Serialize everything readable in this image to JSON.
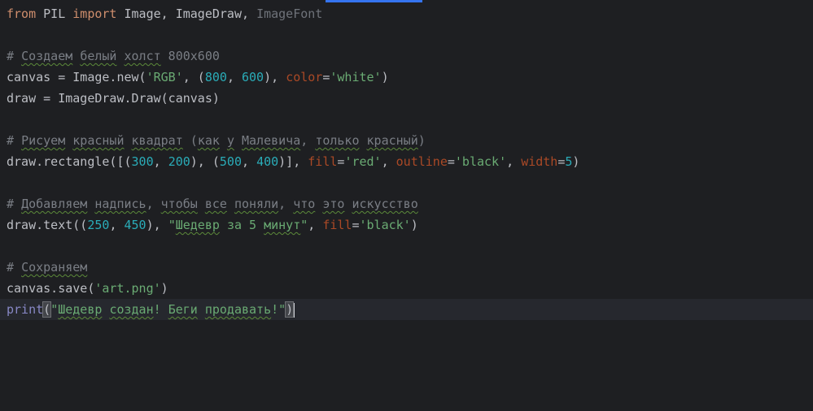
{
  "editor": {
    "colors": {
      "background": "#1e1f22",
      "keyword": "#cf8e6d",
      "string": "#6aab73",
      "number": "#2aacb8",
      "named_parameter": "#aa4926",
      "comment": "#7a7e85",
      "builtin": "#8888c6",
      "default_text": "#bcbec4"
    },
    "lines": {
      "l1": {
        "kw1": "from",
        "t1": " PIL ",
        "kw2": "import",
        "t2": " Image, ImageDraw, ",
        "unused": "ImageFont"
      },
      "l3": {
        "hash": "# ",
        "w1": "Создаем",
        "s1": " ",
        "w2": "белый",
        "s2": " ",
        "w3": "холст",
        "rest": " 800x600"
      },
      "l4": {
        "t1": "canvas = Image.new(",
        "s1": "'RGB'",
        "t2": ", (",
        "n1": "800",
        "t3": ", ",
        "n2": "600",
        "t4": "), ",
        "p1": "color",
        "t5": "=",
        "s2": "'white'",
        "t6": ")"
      },
      "l5": {
        "t1": "draw = ImageDraw.Draw(canvas)"
      },
      "l7": {
        "hash": "# ",
        "w1": "Рисуем",
        "s1": " ",
        "w2": "красный",
        "s2": " ",
        "w3": "квадрат",
        "t1": " (",
        "w4": "как",
        "t2": " ",
        "w5": "у",
        "t3": " ",
        "w6": "Малевича",
        "t4": ", ",
        "w7": "только",
        "t5": " ",
        "w8": "красный",
        "t6": ")"
      },
      "l8": {
        "t1": "draw.rectangle([(",
        "n1": "300",
        "t2": ", ",
        "n2": "200",
        "t3": "), (",
        "n3": "500",
        "t4": ", ",
        "n4": "400",
        "t5": ")], ",
        "p1": "fill",
        "t6": "=",
        "s1": "'red'",
        "t7": ", ",
        "p2": "outline",
        "t8": "=",
        "s2": "'black'",
        "t9": ", ",
        "p3": "width",
        "t10": "=",
        "n5": "5",
        "t11": ")"
      },
      "l10": {
        "hash": "# ",
        "w1": "Добавляем",
        "s1": " ",
        "w2": "надпись",
        "t1": ", ",
        "w3": "чтобы",
        "s2": " ",
        "w4": "все",
        "s3": " ",
        "w5": "поняли",
        "t2": ", ",
        "w6": "что",
        "s4": " ",
        "w7": "это",
        "s5": " ",
        "w8": "искусство"
      },
      "l11": {
        "t1": "draw.text((",
        "n1": "250",
        "t2": ", ",
        "n2": "450",
        "t3": "), ",
        "q1": "\"",
        "w1": "Шедевр",
        "s1": " ",
        "w2": "за",
        "s2": " 5 ",
        "w3": "минут",
        "q2": "\"",
        "t4": ", ",
        "p1": "fill",
        "t5": "=",
        "s3": "'black'",
        "t6": ")"
      },
      "l13": {
        "hash": "# ",
        "w1": "Сохраняем"
      },
      "l14": {
        "t1": "canvas.save(",
        "s1": "'art.png'",
        "t2": ")"
      },
      "l15": {
        "b1": "print",
        "t1": "(",
        "q1": "\"",
        "w1": "Шедевр",
        "s1": " ",
        "w2": "создан",
        "s2": "! ",
        "w3": "Беги",
        "s3": " ",
        "w4": "продавать",
        "s4": "!\"",
        "t2": ")"
      }
    }
  }
}
